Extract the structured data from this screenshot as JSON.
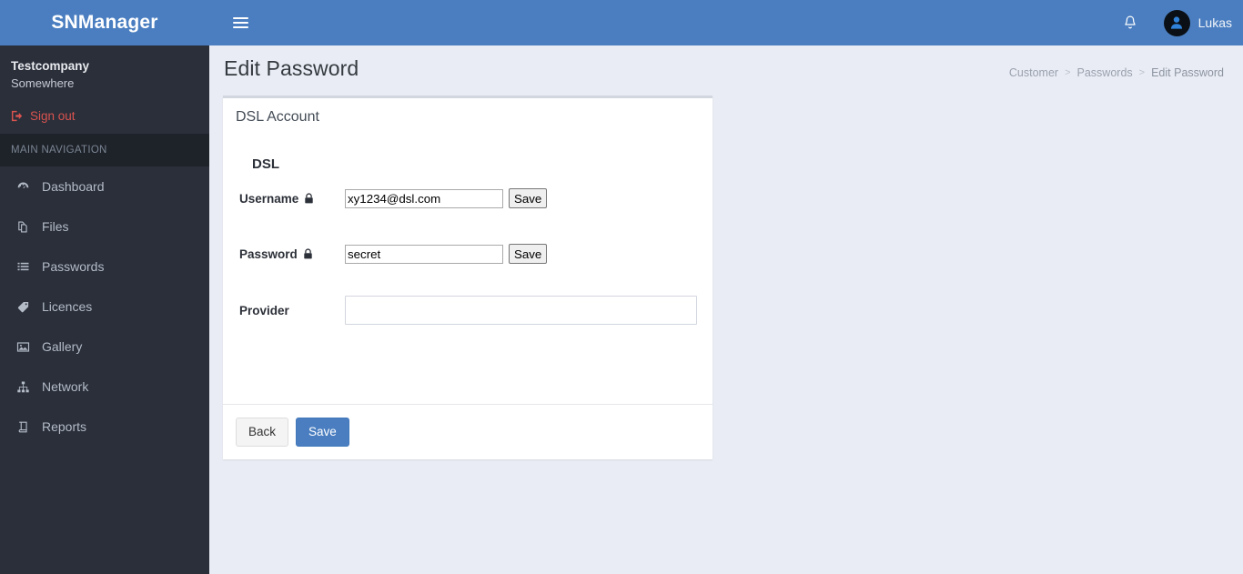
{
  "brand": {
    "name": "SNManager"
  },
  "sidebar": {
    "company": "Testcompany",
    "location": "Somewhere",
    "signout_label": "Sign out",
    "nav_header": "MAIN NAVIGATION",
    "items": [
      {
        "label": "Dashboard",
        "icon": "dashboard-icon"
      },
      {
        "label": "Files",
        "icon": "files-icon"
      },
      {
        "label": "Passwords",
        "icon": "list-icon"
      },
      {
        "label": "Licences",
        "icon": "tag-icon"
      },
      {
        "label": "Gallery",
        "icon": "image-icon"
      },
      {
        "label": "Network",
        "icon": "sitemap-icon"
      },
      {
        "label": "Reports",
        "icon": "book-icon"
      }
    ]
  },
  "topbar": {
    "menu_toggle": "hamburger-icon",
    "bell": "notification-bell-icon",
    "user_name": "Lukas"
  },
  "page": {
    "title": "Edit Password",
    "breadcrumb": [
      {
        "label": "Customer",
        "current": false
      },
      {
        "label": "Passwords",
        "current": false
      },
      {
        "label": "Edit Password",
        "current": true
      }
    ],
    "breadcrumb_separator": ">"
  },
  "card": {
    "title": "DSL Account",
    "section_title": "DSL",
    "fields": [
      {
        "label": "Username",
        "locked": true,
        "value": "xy1234@dsl.com",
        "placeholder": "",
        "save_label": "Save"
      },
      {
        "label": "Password",
        "locked": true,
        "value": "secret",
        "placeholder": "",
        "save_label": "Save"
      },
      {
        "label": "Provider",
        "locked": false,
        "value": "",
        "placeholder": ""
      }
    ],
    "footer": {
      "back_label": "Back",
      "save_label": "Save"
    }
  },
  "colors": {
    "header_blue": "#4a7ec0",
    "sidebar_dark": "#2a2f3a",
    "sidebar_darker": "#1e2229",
    "content_bg": "#e9ecf4",
    "signout_red": "#d9534f",
    "card_top_border": "#d2d6de"
  }
}
